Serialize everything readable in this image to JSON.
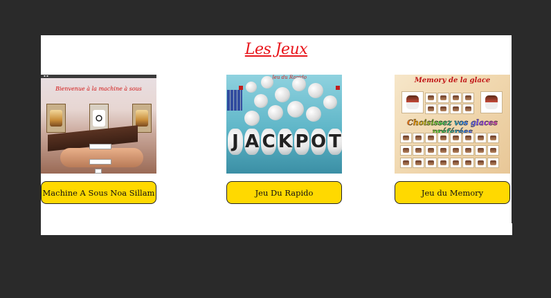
{
  "page": {
    "title": "Les Jeux"
  },
  "games": [
    {
      "button_label": "Machine A Sous Noa Sillam",
      "thumb_text": "Bienvenue à la machine à sous"
    },
    {
      "button_label": "Jeu Du Rapido",
      "thumb_text": "Jeu du Rapido",
      "letters": [
        "J",
        "A",
        "C",
        "K",
        "P",
        "O",
        "T"
      ]
    },
    {
      "button_label": "Jeu du Memory",
      "thumb_title": "Memory de la glace",
      "thumb_banner": "Choisissez vos glaces préférées"
    }
  ],
  "colors": {
    "background": "#2a2a2a",
    "panel": "#ffffff",
    "title": "#e8141a",
    "button": "#ffd900"
  }
}
